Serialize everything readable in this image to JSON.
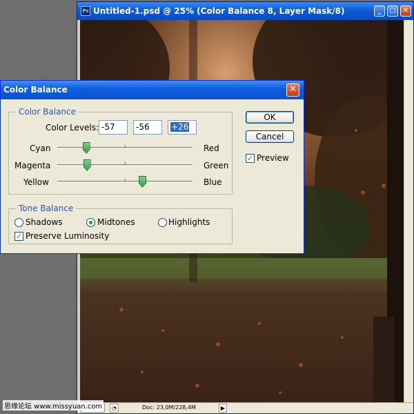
{
  "document_window": {
    "title": "Untitled-1.psd @ 25% (Color Balance 8, Layer Mask/8)",
    "app_icon_text": "Ps",
    "buttons": {
      "minimize": "_",
      "maximize": "□",
      "close": "✕"
    },
    "status": {
      "zoom": "25%",
      "doc_info": "Doc: 23,0M/228,4M",
      "menu_arrow": "▶"
    }
  },
  "dialog": {
    "title": "Color Balance",
    "close_glyph": "✕",
    "color_balance_group": {
      "legend": "Color Balance",
      "color_levels_label": "Color Levels:",
      "levels": [
        "-57",
        "-56",
        "+26"
      ],
      "sliders": [
        {
          "left": "Cyan",
          "right": "Red",
          "value": -57
        },
        {
          "left": "Magenta",
          "right": "Green",
          "value": -56
        },
        {
          "left": "Yellow",
          "right": "Blue",
          "value": 26
        }
      ]
    },
    "tone_balance_group": {
      "legend": "Tone Balance",
      "options": [
        "Shadows",
        "Midtones",
        "Highlights"
      ],
      "selected": "Midtones",
      "preserve_luminosity_label": "Preserve Luminosity",
      "preserve_luminosity_checked": true
    },
    "buttons": {
      "ok": "OK",
      "cancel": "Cancel"
    },
    "preview_label": "Preview",
    "preview_checked": true
  },
  "watermark": "思缘论坛 www.missyuan.com",
  "colors": {
    "titlebar": "#0a51cf",
    "accent_green": "#21a121",
    "legend_blue": "#2256c8"
  }
}
